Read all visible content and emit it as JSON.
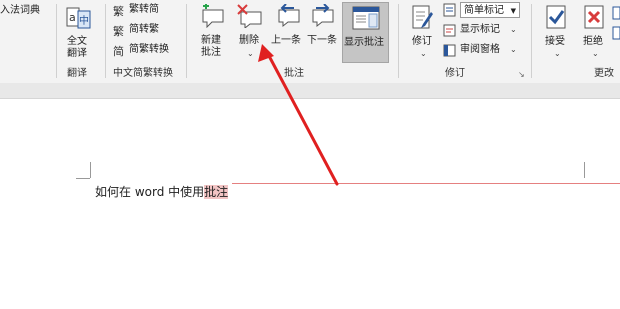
{
  "ribbon": {
    "ime_dict": "入法词典",
    "translate": {
      "full_1": "全文",
      "full_2": "翻译",
      "group": "翻译"
    },
    "chinese": {
      "to_trad": "繁转简",
      "to_simp": "简转繁",
      "convert": "简繁转换",
      "group": "中文简繁转换"
    },
    "comments": {
      "new_1": "新建",
      "new_2": "批注",
      "delete": "删除",
      "prev": "上一条",
      "next": "下一条",
      "show": "显示批注",
      "group": "批注"
    },
    "tracking": {
      "track": "修订",
      "markup_value": "简单标记",
      "show_markup": "显示标记",
      "review_pane": "审阅窗格",
      "group": "修订"
    },
    "changes": {
      "accept": "接受",
      "reject": "拒绝",
      "group": "更改"
    }
  },
  "document": {
    "text_before": "如何在 word 中使用",
    "text_highlight": "批注"
  },
  "colors": {
    "accent": "#2b579a",
    "highlight": "#f2c4c4",
    "arrow": "#e02020",
    "comment_line": "#e58080"
  }
}
